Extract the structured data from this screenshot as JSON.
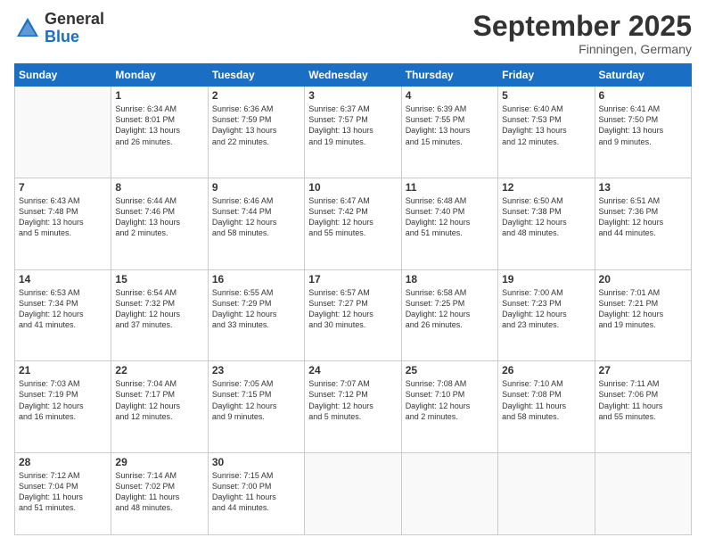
{
  "header": {
    "logo_general": "General",
    "logo_blue": "Blue",
    "month_title": "September 2025",
    "location": "Finningen, Germany"
  },
  "days_of_week": [
    "Sunday",
    "Monday",
    "Tuesday",
    "Wednesday",
    "Thursday",
    "Friday",
    "Saturday"
  ],
  "weeks": [
    [
      {
        "day": "",
        "info": ""
      },
      {
        "day": "1",
        "info": "Sunrise: 6:34 AM\nSunset: 8:01 PM\nDaylight: 13 hours\nand 26 minutes."
      },
      {
        "day": "2",
        "info": "Sunrise: 6:36 AM\nSunset: 7:59 PM\nDaylight: 13 hours\nand 22 minutes."
      },
      {
        "day": "3",
        "info": "Sunrise: 6:37 AM\nSunset: 7:57 PM\nDaylight: 13 hours\nand 19 minutes."
      },
      {
        "day": "4",
        "info": "Sunrise: 6:39 AM\nSunset: 7:55 PM\nDaylight: 13 hours\nand 15 minutes."
      },
      {
        "day": "5",
        "info": "Sunrise: 6:40 AM\nSunset: 7:53 PM\nDaylight: 13 hours\nand 12 minutes."
      },
      {
        "day": "6",
        "info": "Sunrise: 6:41 AM\nSunset: 7:50 PM\nDaylight: 13 hours\nand 9 minutes."
      }
    ],
    [
      {
        "day": "7",
        "info": "Sunrise: 6:43 AM\nSunset: 7:48 PM\nDaylight: 13 hours\nand 5 minutes."
      },
      {
        "day": "8",
        "info": "Sunrise: 6:44 AM\nSunset: 7:46 PM\nDaylight: 13 hours\nand 2 minutes."
      },
      {
        "day": "9",
        "info": "Sunrise: 6:46 AM\nSunset: 7:44 PM\nDaylight: 12 hours\nand 58 minutes."
      },
      {
        "day": "10",
        "info": "Sunrise: 6:47 AM\nSunset: 7:42 PM\nDaylight: 12 hours\nand 55 minutes."
      },
      {
        "day": "11",
        "info": "Sunrise: 6:48 AM\nSunset: 7:40 PM\nDaylight: 12 hours\nand 51 minutes."
      },
      {
        "day": "12",
        "info": "Sunrise: 6:50 AM\nSunset: 7:38 PM\nDaylight: 12 hours\nand 48 minutes."
      },
      {
        "day": "13",
        "info": "Sunrise: 6:51 AM\nSunset: 7:36 PM\nDaylight: 12 hours\nand 44 minutes."
      }
    ],
    [
      {
        "day": "14",
        "info": "Sunrise: 6:53 AM\nSunset: 7:34 PM\nDaylight: 12 hours\nand 41 minutes."
      },
      {
        "day": "15",
        "info": "Sunrise: 6:54 AM\nSunset: 7:32 PM\nDaylight: 12 hours\nand 37 minutes."
      },
      {
        "day": "16",
        "info": "Sunrise: 6:55 AM\nSunset: 7:29 PM\nDaylight: 12 hours\nand 33 minutes."
      },
      {
        "day": "17",
        "info": "Sunrise: 6:57 AM\nSunset: 7:27 PM\nDaylight: 12 hours\nand 30 minutes."
      },
      {
        "day": "18",
        "info": "Sunrise: 6:58 AM\nSunset: 7:25 PM\nDaylight: 12 hours\nand 26 minutes."
      },
      {
        "day": "19",
        "info": "Sunrise: 7:00 AM\nSunset: 7:23 PM\nDaylight: 12 hours\nand 23 minutes."
      },
      {
        "day": "20",
        "info": "Sunrise: 7:01 AM\nSunset: 7:21 PM\nDaylight: 12 hours\nand 19 minutes."
      }
    ],
    [
      {
        "day": "21",
        "info": "Sunrise: 7:03 AM\nSunset: 7:19 PM\nDaylight: 12 hours\nand 16 minutes."
      },
      {
        "day": "22",
        "info": "Sunrise: 7:04 AM\nSunset: 7:17 PM\nDaylight: 12 hours\nand 12 minutes."
      },
      {
        "day": "23",
        "info": "Sunrise: 7:05 AM\nSunset: 7:15 PM\nDaylight: 12 hours\nand 9 minutes."
      },
      {
        "day": "24",
        "info": "Sunrise: 7:07 AM\nSunset: 7:12 PM\nDaylight: 12 hours\nand 5 minutes."
      },
      {
        "day": "25",
        "info": "Sunrise: 7:08 AM\nSunset: 7:10 PM\nDaylight: 12 hours\nand 2 minutes."
      },
      {
        "day": "26",
        "info": "Sunrise: 7:10 AM\nSunset: 7:08 PM\nDaylight: 11 hours\nand 58 minutes."
      },
      {
        "day": "27",
        "info": "Sunrise: 7:11 AM\nSunset: 7:06 PM\nDaylight: 11 hours\nand 55 minutes."
      }
    ],
    [
      {
        "day": "28",
        "info": "Sunrise: 7:12 AM\nSunset: 7:04 PM\nDaylight: 11 hours\nand 51 minutes."
      },
      {
        "day": "29",
        "info": "Sunrise: 7:14 AM\nSunset: 7:02 PM\nDaylight: 11 hours\nand 48 minutes."
      },
      {
        "day": "30",
        "info": "Sunrise: 7:15 AM\nSunset: 7:00 PM\nDaylight: 11 hours\nand 44 minutes."
      },
      {
        "day": "",
        "info": ""
      },
      {
        "day": "",
        "info": ""
      },
      {
        "day": "",
        "info": ""
      },
      {
        "day": "",
        "info": ""
      }
    ]
  ]
}
